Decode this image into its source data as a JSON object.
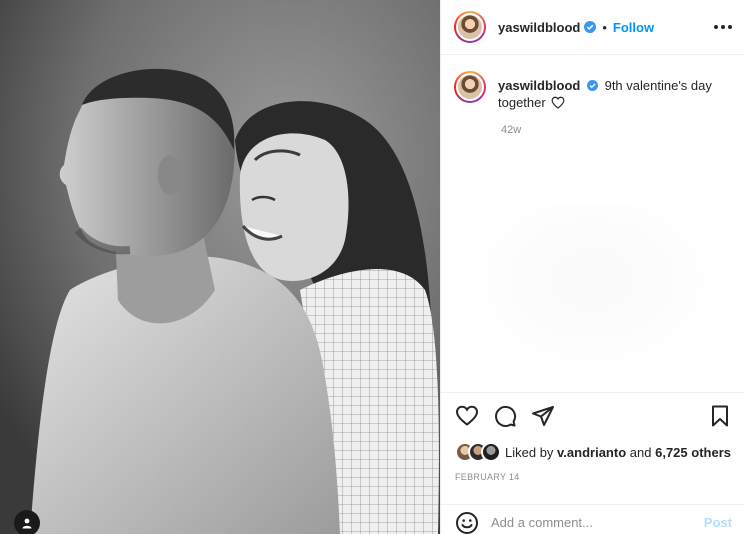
{
  "post": {
    "username": "yaswildblood",
    "follow_label": "Follow",
    "separator": "•",
    "caption_text": "9th valentine's day together",
    "time_ago": "42w",
    "likes_prefix": "Liked by",
    "liked_by_user": "v.andrianto",
    "likes_and": "and",
    "likes_count": "6,725 others",
    "date": "FEBRUARY 14"
  },
  "comment": {
    "placeholder": "Add a comment...",
    "post_label": "Post"
  },
  "colors": {
    "accent": "#0095f6",
    "post_disabled": "#b2dffc",
    "verified": "#3897f0"
  },
  "icons": {
    "like": "heart-outline-icon",
    "comment": "comment-bubble-icon",
    "share": "paper-plane-icon",
    "save": "bookmark-icon",
    "emoji": "smiley-icon",
    "more": "ellipsis-icon",
    "tag": "person-tag-icon"
  }
}
